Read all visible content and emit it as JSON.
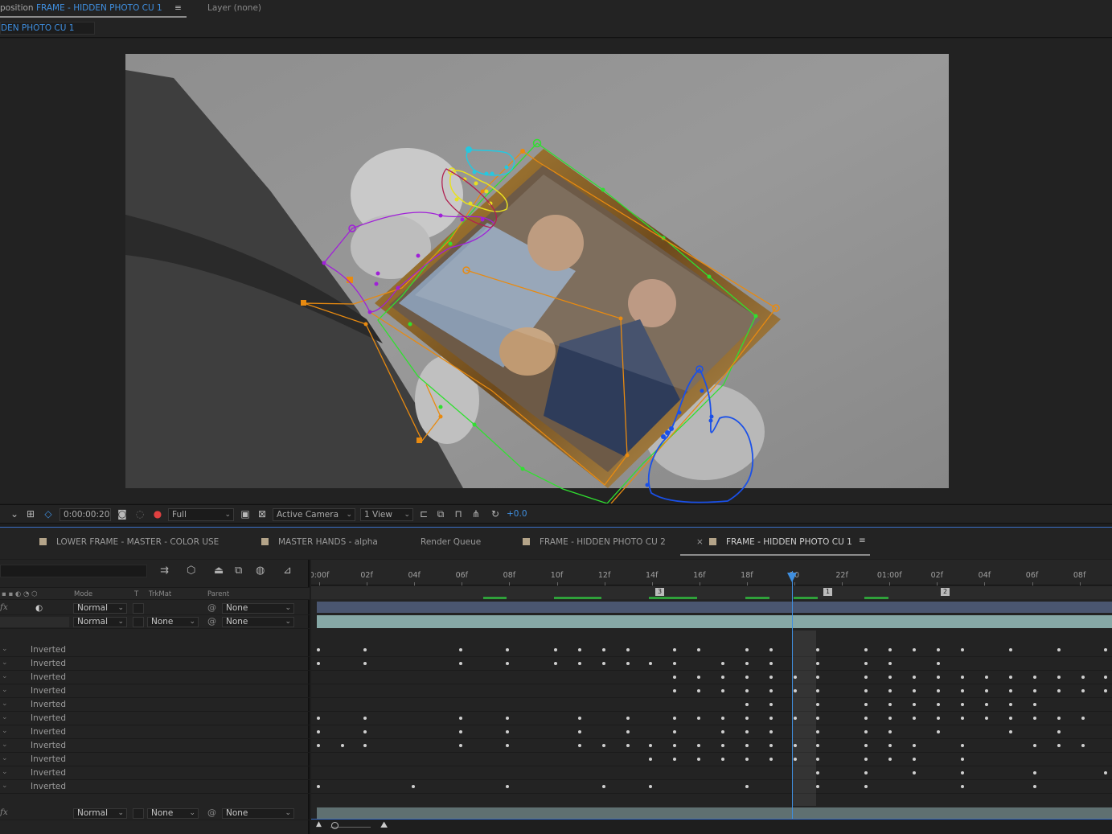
{
  "composition_panel": {
    "tab_prefix": "position",
    "tab_name": "FRAME - HIDDEN PHOTO CU 1",
    "layer_tab": "Layer (none)",
    "breadcrumb": "DEN PHOTO CU 1"
  },
  "viewer_toolbar": {
    "timecode": "0:00:00:20",
    "resolution": "Full",
    "camera": "Active Camera",
    "views": "1 View",
    "exposure": "+0.0"
  },
  "timeline_tabs": [
    {
      "label": "LOWER FRAME - MASTER - COLOR USE",
      "swatch": "#b4a489"
    },
    {
      "label": "MASTER HANDS - alpha",
      "swatch": "#b4a489"
    },
    {
      "label": "Render Queue",
      "swatch": ""
    },
    {
      "label": "FRAME - HIDDEN PHOTO CU 2",
      "swatch": "#b4a489"
    },
    {
      "label": "FRAME - HIDDEN PHOTO CU 1",
      "swatch": "#b4a489",
      "active": true
    }
  ],
  "layer_columns": {
    "mode": "Mode",
    "t": "T",
    "trkmat": "TrkMat",
    "parent": "Parent"
  },
  "layers": [
    {
      "fx": "fx",
      "mode": "Normal",
      "trkmat": "",
      "parent": "None"
    },
    {
      "fx": "",
      "mode": "Normal",
      "trkmat": "None",
      "parent": "None"
    }
  ],
  "masks": [
    {
      "mode": "Inverted"
    },
    {
      "mode": "Inverted"
    },
    {
      "mode": "Inverted"
    },
    {
      "mode": "Inverted"
    },
    {
      "mode": "Inverted"
    },
    {
      "mode": "Inverted"
    },
    {
      "mode": "Inverted"
    },
    {
      "mode": "Inverted"
    },
    {
      "mode": "Inverted"
    },
    {
      "mode": "Inverted"
    },
    {
      "mode": "Inverted"
    }
  ],
  "bottom_layer": {
    "fx": "fx",
    "mode": "Normal",
    "trkmat": "None",
    "parent": "None"
  },
  "ruler": {
    "labels": [
      "0:00f",
      "02f",
      "04f",
      "06f",
      "08f",
      "10f",
      "12f",
      "14f",
      "16f",
      "18f",
      "20",
      "22f",
      "01:00f",
      "02f",
      "04f",
      "06f",
      "08f"
    ],
    "current_frame": 20
  },
  "markers": [
    "3",
    "1",
    "2"
  ],
  "colors": {
    "accent": "#3f8fe0",
    "timeline_bar": "#86a8a6",
    "layer_bar": "#4a5670",
    "label_swatch": "#b4a489",
    "marker_green": "#2fa13a"
  },
  "mask_path_colors": [
    "#25c8e0",
    "#e8e020",
    "#a020d8",
    "#e88a10",
    "#30e030",
    "#1a50e8"
  ]
}
